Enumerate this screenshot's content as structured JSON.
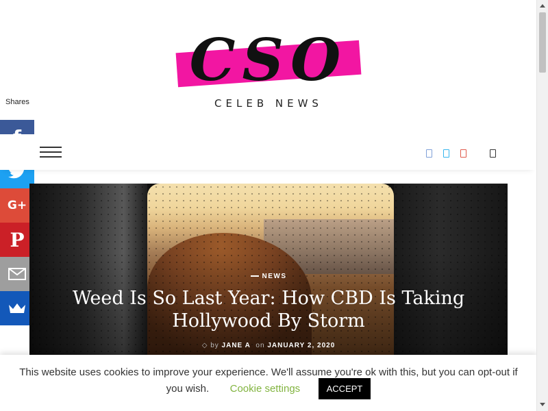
{
  "site": {
    "logo_text": "CSO",
    "logo_subtitle": "CELEB NEWS"
  },
  "nav": {
    "menu_icon": "hamburger-icon",
    "social_icons": [
      "facebook-icon",
      "twitter-icon",
      "pinterest-icon"
    ],
    "search_icon": "search-icon"
  },
  "share_bar": {
    "label": "Shares",
    "buttons": [
      {
        "network": "facebook",
        "glyph": "f",
        "color": "#3b5998"
      },
      {
        "network": "twitter",
        "glyph": "",
        "color": "#1da1f2"
      },
      {
        "network": "google-plus",
        "glyph": "G+",
        "color": "#dd4b39"
      },
      {
        "network": "pinterest",
        "glyph": "P",
        "color": "#cb2027"
      },
      {
        "network": "email",
        "glyph": "",
        "color": "#9e9e9e"
      },
      {
        "network": "sumo",
        "glyph": "",
        "color": "#1358b9"
      }
    ]
  },
  "hero": {
    "category": "NEWS",
    "title": "Weed Is So Last Year: How CBD Is Taking Hollywood By Storm",
    "by": "by",
    "author": "JANE A",
    "on": "on",
    "date": "JANUARY 2, 2020"
  },
  "cookie": {
    "text": "This website uses cookies to improve your experience. We'll assume you're ok with this, but you can opt-out if",
    "text_end": "you wish.",
    "settings_label": "Cookie settings",
    "accept_label": "ACCEPT",
    "settings_color": "#82b440"
  },
  "colors": {
    "brand_pink": "#f216a2"
  }
}
